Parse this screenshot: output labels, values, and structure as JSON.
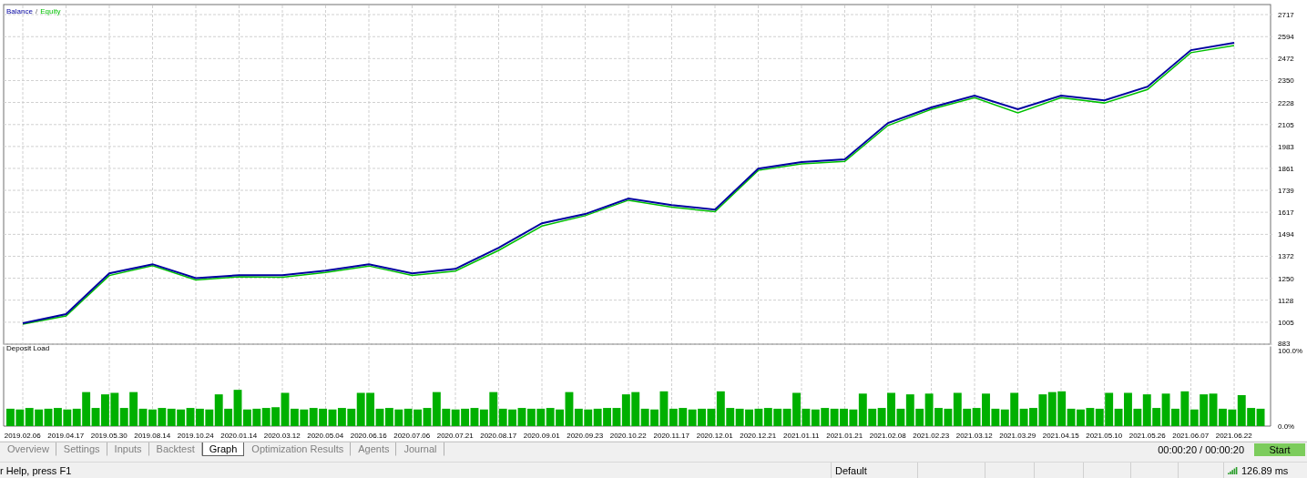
{
  "balance_chart": {
    "chart_data": {
      "type": "line",
      "grid": true,
      "categories": [
        null,
        null,
        null,
        null,
        null,
        null,
        null,
        null,
        null,
        null,
        null,
        null,
        null,
        null,
        null,
        null,
        null,
        null,
        null,
        null,
        null,
        null,
        null,
        null,
        null,
        null,
        null,
        null,
        null
      ],
      "series": [
        {
          "name": "Balance",
          "color": "#0000a0",
          "values": [
            1000,
            1050,
            1277,
            1328,
            1250,
            1267,
            1267,
            1292,
            1328,
            1277,
            1302,
            1419,
            1556,
            1607,
            1693,
            1657,
            1632,
            1860,
            1896,
            1911,
            2114,
            2200,
            2266,
            2190,
            2266,
            2240,
            2316,
            2519,
            2560
          ]
        },
        {
          "name": "Equity",
          "color": "#00c000",
          "values": [
            995,
            1040,
            1265,
            1320,
            1240,
            1258,
            1255,
            1282,
            1318,
            1265,
            1290,
            1405,
            1540,
            1598,
            1684,
            1645,
            1620,
            1850,
            1886,
            1900,
            2100,
            2190,
            2255,
            2170,
            2255,
            2225,
            2300,
            2505,
            2545
          ]
        }
      ],
      "ylim": [
        883,
        2717
      ],
      "yticks": [
        883,
        1005,
        1128,
        1250,
        1372,
        1494,
        1617,
        1739,
        1861,
        1983,
        2105,
        2228,
        2350,
        2472,
        2594,
        2717
      ]
    },
    "legend_separator": "/"
  },
  "deposit_chart": {
    "chart_data": {
      "type": "bar",
      "title": "Deposit Load",
      "ylim": [
        0,
        106
      ],
      "yticks": [
        {
          "value": 0,
          "label": "0.0%"
        },
        {
          "value": 100,
          "label": "100.0%"
        }
      ],
      "categories": [
        null,
        null,
        null,
        null,
        null,
        null,
        null,
        null,
        null,
        null,
        null,
        null,
        null,
        null,
        null,
        null,
        null,
        null,
        null,
        null,
        null,
        null,
        null,
        null,
        null,
        null,
        null,
        null,
        null,
        null,
        null,
        null,
        null,
        null,
        null,
        null,
        null,
        null,
        null,
        null,
        null,
        null,
        null,
        null,
        null,
        null,
        null,
        null,
        null,
        null,
        null,
        null,
        null,
        null,
        null,
        null,
        null,
        null,
        null,
        null,
        null,
        null,
        null,
        null,
        null,
        null,
        null,
        null,
        null,
        null,
        null,
        null,
        null,
        null,
        null,
        null,
        null,
        null,
        null,
        null,
        null,
        null,
        null,
        null,
        null,
        null,
        null,
        null,
        null,
        null,
        null,
        null,
        null,
        null,
        null,
        null,
        null,
        null,
        null,
        null,
        null,
        null,
        null,
        null,
        null,
        null,
        null,
        null,
        null,
        null,
        null,
        null,
        null,
        null,
        null,
        null,
        null,
        null,
        null,
        null,
        null,
        null,
        null,
        null,
        null,
        null,
        null,
        null,
        null,
        null,
        null,
        null,
        null
      ],
      "values": [
        23,
        22,
        24,
        22,
        23,
        24,
        22,
        23,
        45,
        24,
        42,
        44,
        24,
        45,
        23,
        22,
        24,
        23,
        22,
        24,
        23,
        22,
        42,
        23,
        48,
        22,
        23,
        24,
        25,
        44,
        23,
        22,
        24,
        23,
        22,
        24,
        23,
        44,
        44,
        23,
        24,
        22,
        23,
        22,
        24,
        45,
        23,
        22,
        23,
        24,
        22,
        45,
        23,
        22,
        24,
        23,
        23,
        24,
        22,
        45,
        23,
        22,
        23,
        24,
        24,
        42,
        45,
        23,
        22,
        46,
        23,
        24,
        22,
        23,
        23,
        46,
        24,
        23,
        22,
        23,
        24,
        23,
        23,
        44,
        23,
        22,
        24,
        23,
        23,
        22,
        43,
        23,
        24,
        44,
        23,
        42,
        23,
        43,
        24,
        23,
        44,
        23,
        24,
        43,
        23,
        22,
        44,
        23,
        24,
        42,
        45,
        46,
        23,
        22,
        24,
        23,
        44,
        23,
        44,
        23,
        42,
        24,
        43,
        23,
        46,
        22,
        42,
        43,
        23,
        22,
        41,
        24,
        23
      ]
    }
  },
  "date_axis": [
    "2019.02.06",
    "2019.04.17",
    "2019.05.30",
    "2019.08.14",
    "2019.10.24",
    "2020.01.14",
    "2020.03.12",
    "2020.05.04",
    "2020.06.16",
    "2020.07.06",
    "2020.07.21",
    "2020.08.17",
    "2020.09.01",
    "2020.09.23",
    "2020.10.22",
    "2020.11.17",
    "2020.12.01",
    "2020.12.21",
    "2021.01.11",
    "2021.01.21",
    "2021.02.08",
    "2021.02.23",
    "2021.03.12",
    "2021.03.29",
    "2021.04.15",
    "2021.05.10",
    "2021.05.26",
    "2021.06.07",
    "2021.06.22"
  ],
  "tabs": [
    {
      "label": "Overview",
      "selected": false
    },
    {
      "label": "Settings",
      "selected": false
    },
    {
      "label": "Inputs",
      "selected": false
    },
    {
      "label": "Backtest",
      "selected": false
    },
    {
      "label": "Graph",
      "selected": true
    },
    {
      "label": "Optimization Results",
      "selected": false
    },
    {
      "label": "Agents",
      "selected": false
    },
    {
      "label": "Journal",
      "selected": false
    }
  ],
  "timer": "00:00:20 / 00:00:20",
  "start_button": "Start",
  "status_bar": {
    "help": "r Help, press F1",
    "profile": "Default",
    "ping": "126.89 ms"
  }
}
